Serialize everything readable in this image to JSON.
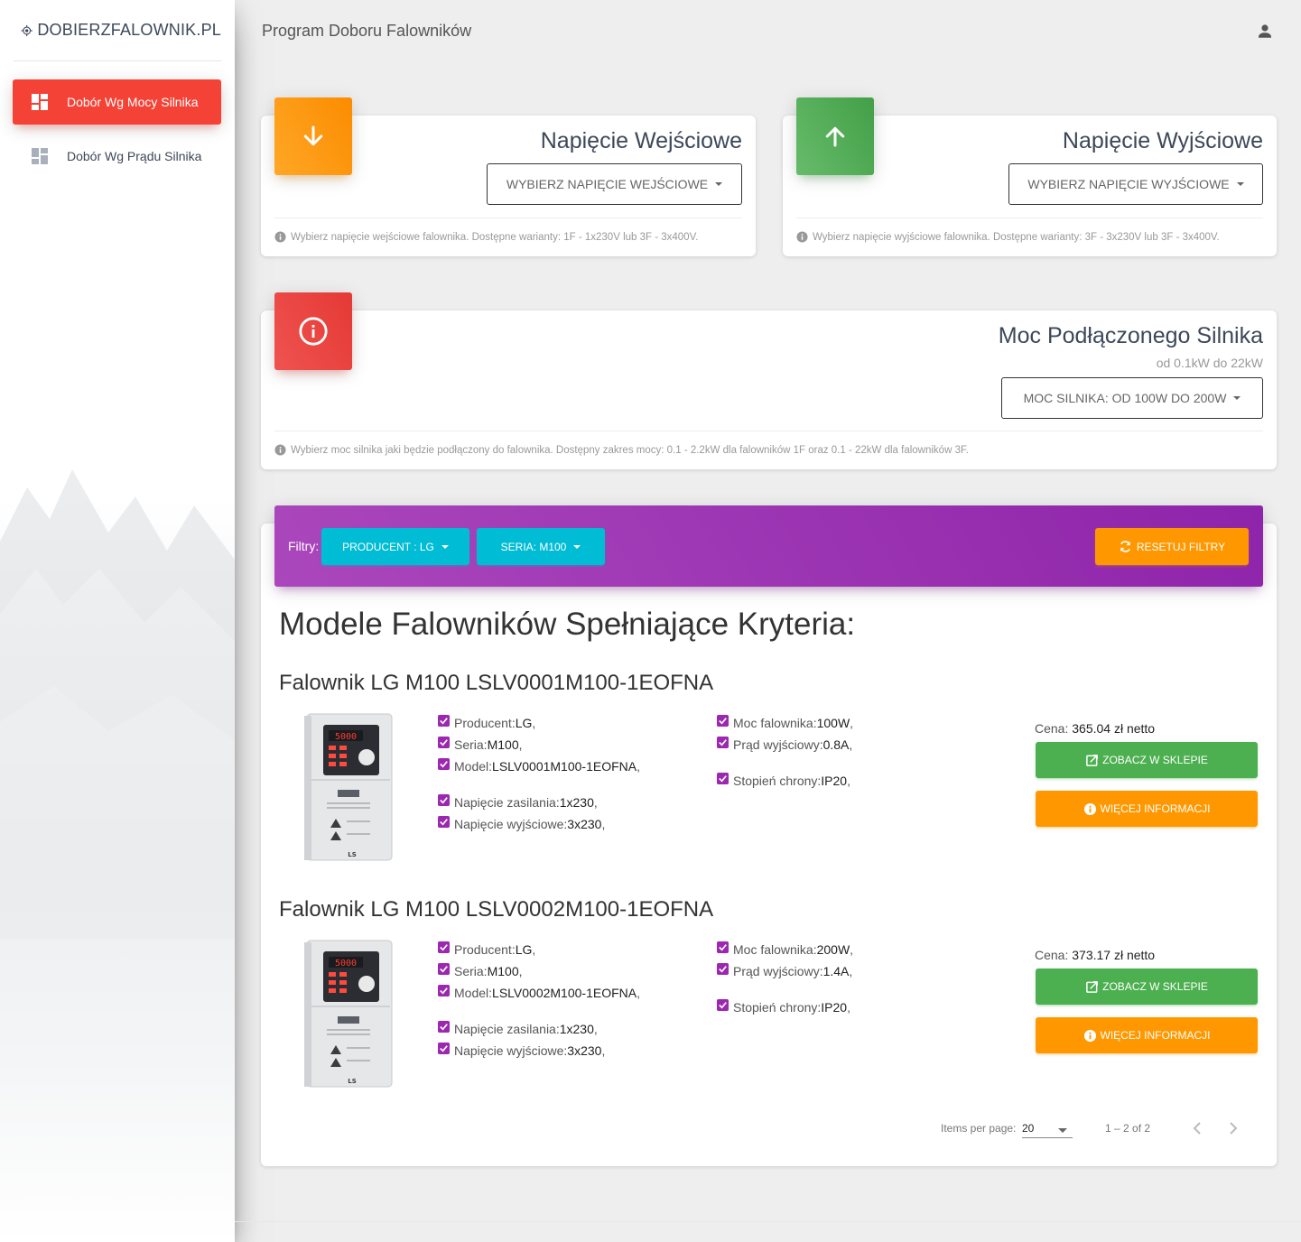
{
  "sidebar": {
    "logo_text": "DOBIERZFALOWNIK.PL",
    "items": [
      {
        "label": "Dobór Wg Mocy Silnika",
        "active": true,
        "icon": "dashboard-icon"
      },
      {
        "label": "Dobór Wg Prądu Silnika",
        "active": false,
        "icon": "dashboard-icon"
      }
    ]
  },
  "header": {
    "title": "Program Doboru Falowników",
    "user_icon": "person-icon"
  },
  "input_voltage": {
    "title": "Napięcie Wejściowe",
    "button": "WYBIERZ NAPIĘCIE WEJŚCIOWE",
    "hint": "Wybierz napięcie wejściowe falownika. Dostępne warianty: 1F - 1x230V lub 3F - 3x400V.",
    "icon": "arrow-down-icon",
    "color": "#fb8c00"
  },
  "output_voltage": {
    "title": "Napięcie Wyjściowe",
    "button": "WYBIERZ NAPIĘCIE WYJŚCIOWE",
    "hint": "Wybierz napięcie wyjściowe falownika. Dostępne warianty: 3F - 3x230V lub 3F - 3x400V.",
    "icon": "arrow-up-icon",
    "color": "#43a047"
  },
  "motor_power": {
    "title": "Moc Podłączonego Silnika",
    "subtitle": "od 0.1kW do 22kW",
    "button": "MOC SILNIKA: OD 100W DO 200W",
    "hint": "Wybierz moc silnika jaki będzie podłączony do falownika. Dostępny zakres mocy: 0.1 - 2.2kW dla falowników 1F oraz 0.1 - 22kW dla falowników 3F.",
    "icon": "info-icon",
    "color": "#e53935"
  },
  "filters": {
    "label": "Filtry:",
    "producer": "PRODUCENT : LG",
    "series": "SERIA: M100",
    "reset": "RESETUJ FILTRY",
    "color": "#9c27b0"
  },
  "results": {
    "title": "Modele Falowników Spełniające Kryteria:",
    "products": [
      {
        "title": "Falownik LG M100 LSLV0001M100-1EOFNA",
        "specs_left": [
          {
            "label": "Producent: ",
            "value": "LG",
            "suffix": ","
          },
          {
            "label": "Seria: ",
            "value": "M100",
            "suffix": ","
          },
          {
            "label": "Model:",
            "value": "LSLV0001M100-1EOFNA",
            "suffix": ","
          },
          {
            "label": "Napięcie zasilania: ",
            "value": "1x230",
            "suffix": ","
          },
          {
            "label": "Napięcie wyjściowe: ",
            "value": "3x230",
            "suffix": ","
          }
        ],
        "specs_right": [
          {
            "label": "Moc falownika: ",
            "value": "100W",
            "suffix": ","
          },
          {
            "label": "Prąd wyjściowy: ",
            "value": "0.8A",
            "suffix": ","
          },
          {
            "label": "Stopień chrony: ",
            "value": "IP20",
            "suffix": ","
          }
        ],
        "price_label": "Cena: ",
        "price": "365.04 zł netto",
        "shop_button": "ZOBACZ W SKLEPIE",
        "info_button": "WIĘCEJ INFORMACJI",
        "display": "5000"
      },
      {
        "title": "Falownik LG M100 LSLV0002M100-1EOFNA",
        "specs_left": [
          {
            "label": "Producent: ",
            "value": "LG",
            "suffix": ","
          },
          {
            "label": "Seria: ",
            "value": "M100",
            "suffix": ","
          },
          {
            "label": "Model:",
            "value": "LSLV0002M100-1EOFNA",
            "suffix": ","
          },
          {
            "label": "Napięcie zasilania: ",
            "value": "1x230",
            "suffix": ","
          },
          {
            "label": "Napięcie wyjściowe: ",
            "value": "3x230",
            "suffix": ","
          }
        ],
        "specs_right": [
          {
            "label": "Moc falownika: ",
            "value": "200W",
            "suffix": ","
          },
          {
            "label": "Prąd wyjściowy: ",
            "value": "1.4A",
            "suffix": ","
          },
          {
            "label": "Stopień chrony: ",
            "value": "IP20",
            "suffix": ","
          }
        ],
        "price_label": "Cena: ",
        "price": "373.17 zł netto",
        "shop_button": "ZOBACZ W SKLEPIE",
        "info_button": "WIĘCEJ INFORMACJI",
        "display": "5000"
      }
    ]
  },
  "paginator": {
    "items_per_page_label": "Items per page:",
    "page_size": "20",
    "range": "1 – 2 of 2",
    "prev_icon": "chevron-left-icon",
    "next_icon": "chevron-right-icon"
  },
  "colors": {
    "checkbox": "#9c27b0",
    "success": "#4caf50",
    "warning": "#ff9800",
    "info": "#00bcd4",
    "danger": "#f44336"
  }
}
